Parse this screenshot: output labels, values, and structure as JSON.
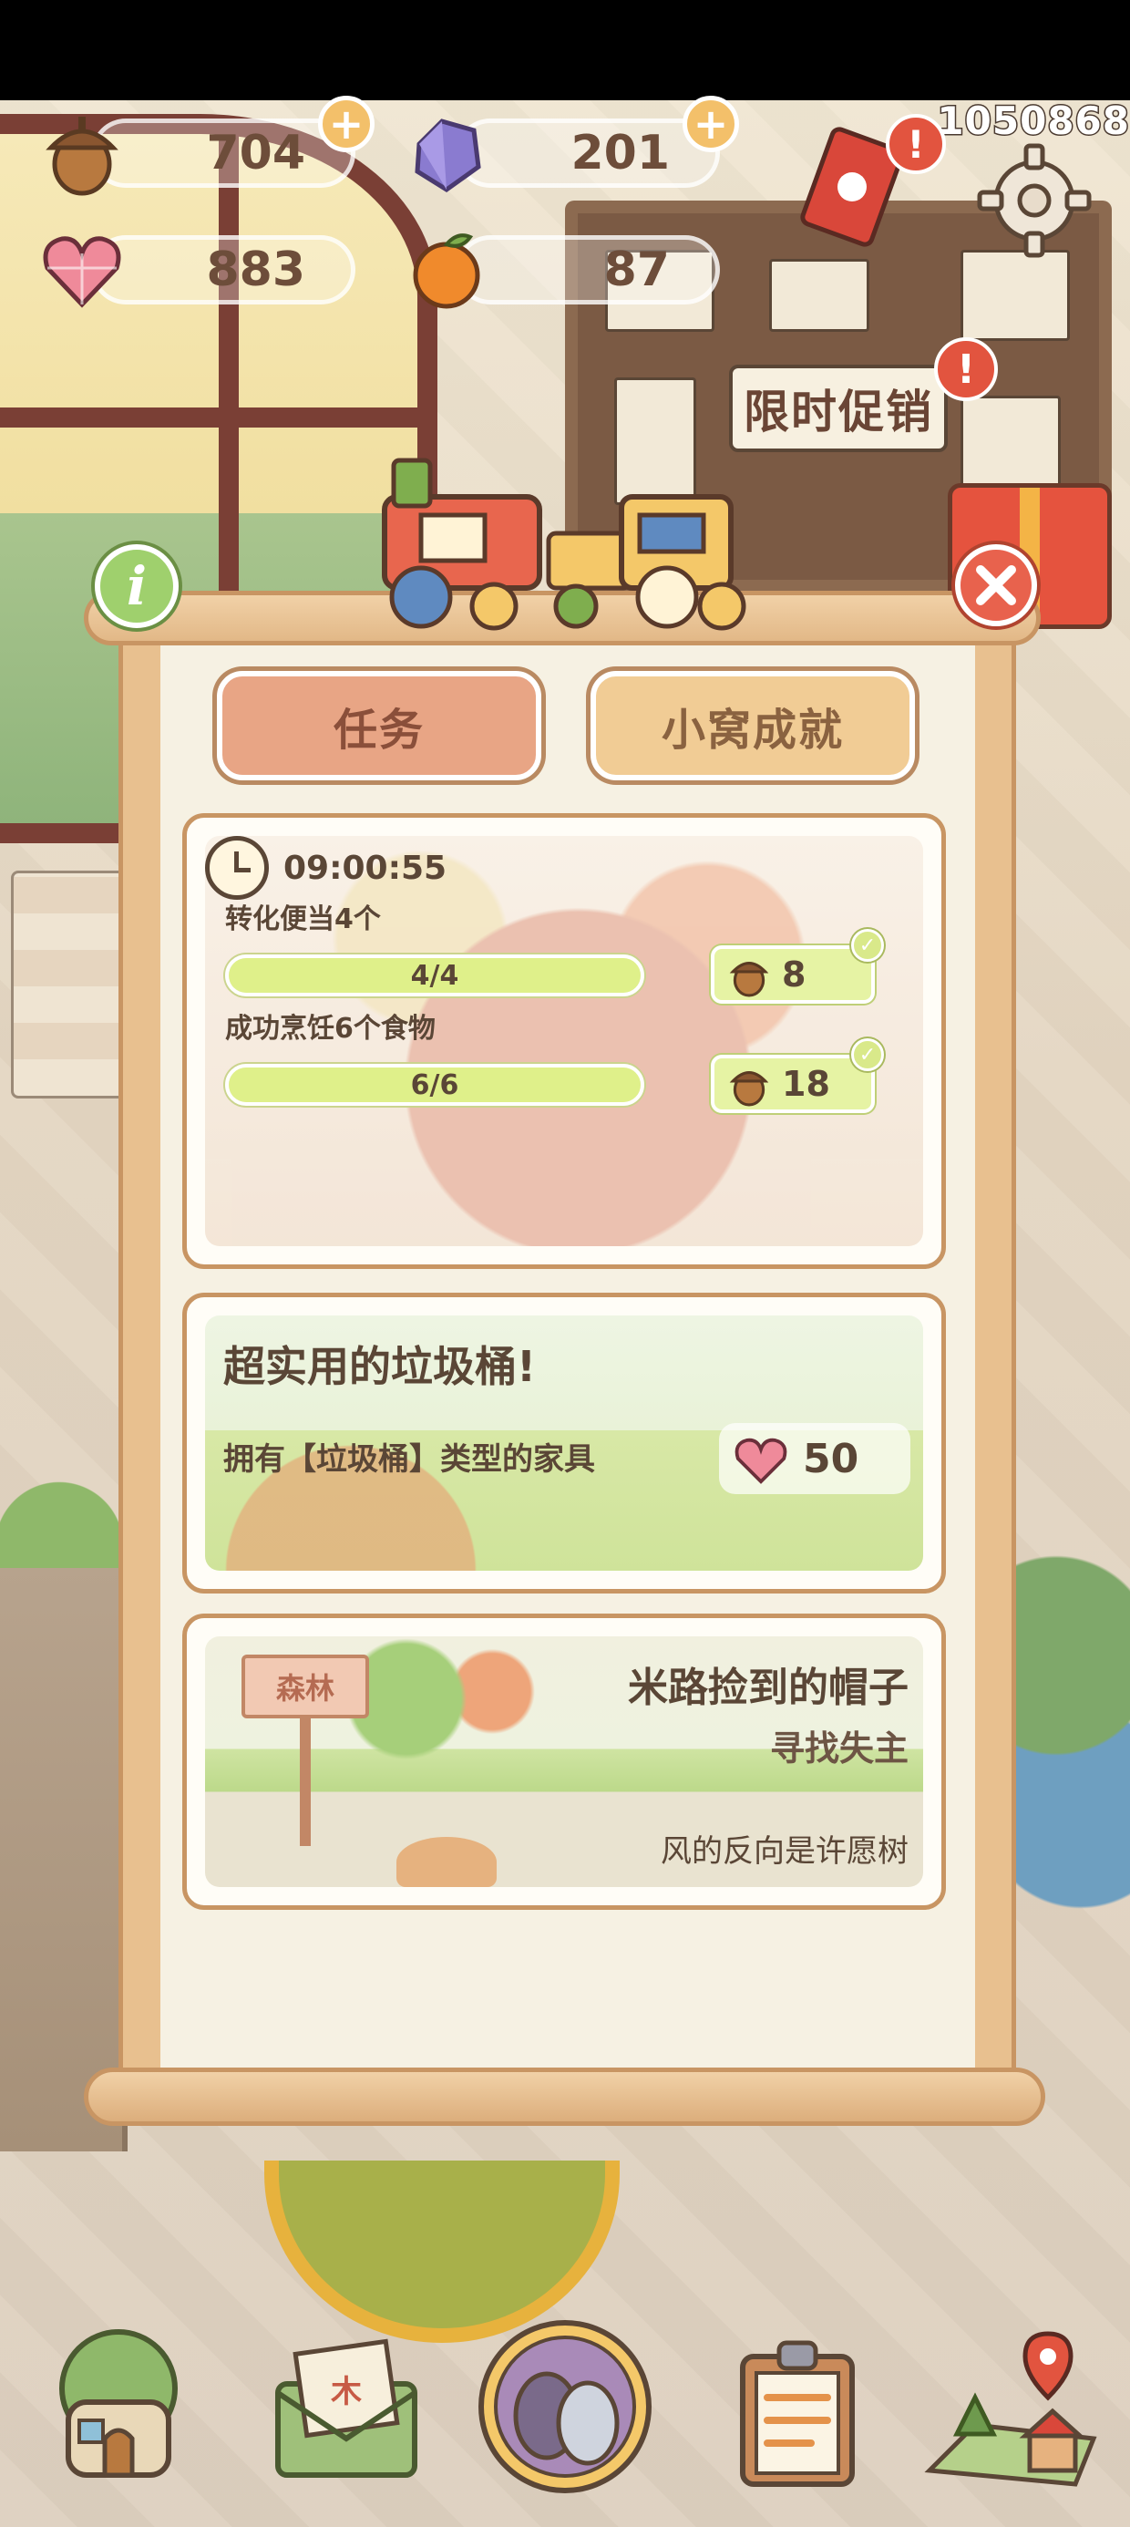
{
  "hud": {
    "player_id": "1050868",
    "resources": [
      {
        "name": "acorns",
        "value": "704",
        "icon": "acorn-icon"
      },
      {
        "name": "gems",
        "value": "201",
        "icon": "crystal-icon"
      },
      {
        "name": "hearts",
        "value": "883",
        "icon": "heart-gem-icon"
      },
      {
        "name": "oranges",
        "value": "87",
        "icon": "orange-icon"
      }
    ],
    "alert_mark": "!",
    "promo_label": "限时促销"
  },
  "panel": {
    "info_glyph": "i",
    "tabs": [
      {
        "label": "任务",
        "active": true
      },
      {
        "label": "小窝成就",
        "active": false
      }
    ],
    "task_card": {
      "timer": "09:00:55",
      "tasks": [
        {
          "label": "转化便当4个",
          "progress": "4/4",
          "fraction": 1.0,
          "reward": "8",
          "reward_icon": "acorn-icon",
          "done": true
        },
        {
          "label": "成功烹饪6个食物",
          "progress": "6/6",
          "fraction": 1.0,
          "reward": "18",
          "reward_icon": "acorn-icon",
          "done": true
        }
      ]
    },
    "achievement_card": {
      "title": "超实用的垃圾桶!",
      "description": "拥有【垃圾桶】类型的家具",
      "reward": "50",
      "reward_icon": "heart-gem-icon"
    },
    "quest_card": {
      "sign_text": "森林",
      "title": "米路捡到的帽子",
      "subtitle": "寻找失主",
      "hint": "风的反向是许愿树"
    }
  },
  "bottom_nav": [
    {
      "name": "home",
      "icon": "treehouse-icon"
    },
    {
      "name": "mail",
      "icon": "letter-icon"
    },
    {
      "name": "gacha",
      "icon": "egg-icon"
    },
    {
      "name": "tasks",
      "icon": "clipboard-icon"
    },
    {
      "name": "map",
      "icon": "map-pin-icon"
    }
  ],
  "colors": {
    "accent_tab": "#e8a585",
    "progress_fill": "#dff08a",
    "close": "#e8624d",
    "info": "#9fd06d"
  }
}
